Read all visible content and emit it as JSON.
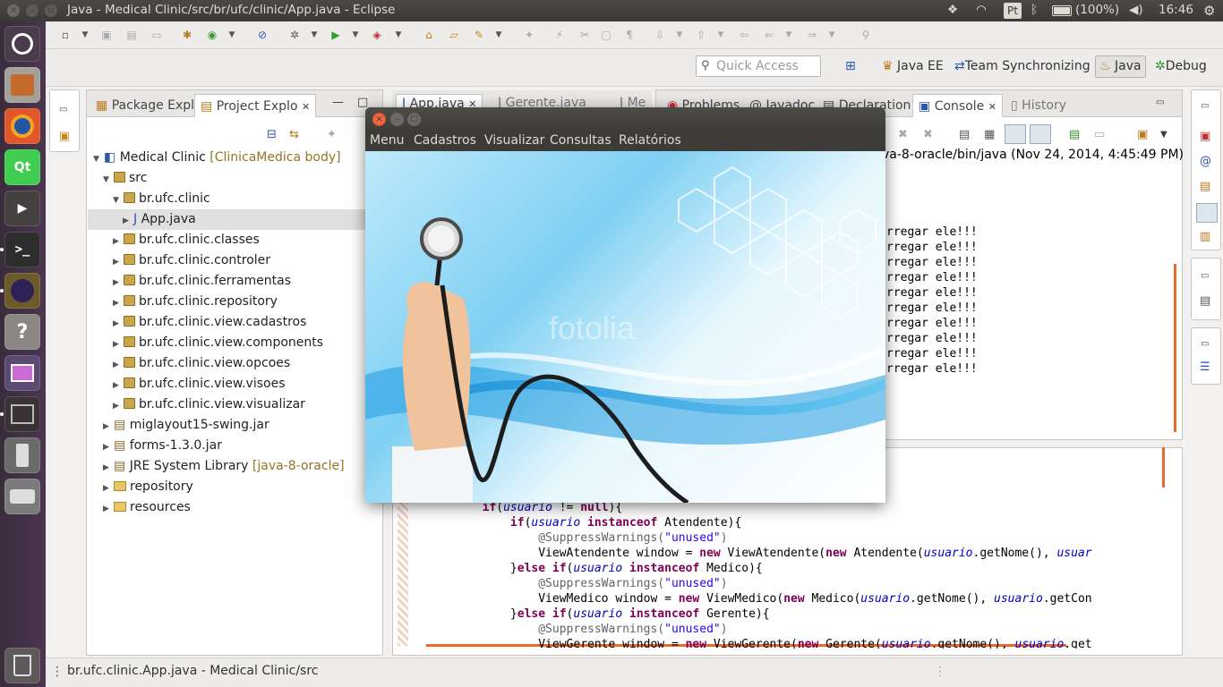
{
  "top_panel": {
    "title": "Java - Medical Clinic/src/br/ufc/clinic/App.java - Eclipse",
    "keyboard": "Pt",
    "battery": "(100%)",
    "time": "16:46",
    "icons": [
      "dropbox-icon",
      "wifi-icon",
      "keyboard-layout-icon",
      "bluetooth-icon",
      "battery-icon",
      "volume-icon",
      "settings-gear-icon"
    ]
  },
  "launcher": {
    "items": [
      "dash-home-icon",
      "files-icon",
      "firefox-icon",
      "qt-creator-icon",
      "video-editor-icon",
      "terminal-icon",
      "eclipse-icon",
      "help-icon",
      "workspace-switcher-icon",
      "system-monitor-icon",
      "usb-drive-icon",
      "disk-drive-icon",
      "trash-icon"
    ]
  },
  "toolbar": {
    "quick_access_placeholder": "Quick Access",
    "perspectives": [
      "Java EE",
      "Team Synchronizing",
      "Java",
      "Debug"
    ]
  },
  "left_pane": {
    "tabs": [
      "Package Expl",
      "Project Explo"
    ],
    "tree": [
      {
        "label": "Medical Clinic",
        "deco": "[ClinicaMedica body]",
        "level": 0,
        "expanded": true,
        "kind": "project"
      },
      {
        "label": "src",
        "level": 1,
        "expanded": true,
        "kind": "srcfolder"
      },
      {
        "label": "br.ufc.clinic",
        "level": 2,
        "expanded": true,
        "kind": "package"
      },
      {
        "label": "App.java",
        "level": 3,
        "expanded": false,
        "kind": "java",
        "selected": true
      },
      {
        "label": "br.ufc.clinic.classes",
        "level": 2,
        "kind": "package"
      },
      {
        "label": "br.ufc.clinic.controler",
        "level": 2,
        "kind": "package"
      },
      {
        "label": "br.ufc.clinic.ferramentas",
        "level": 2,
        "kind": "package"
      },
      {
        "label": "br.ufc.clinic.repository",
        "level": 2,
        "kind": "package"
      },
      {
        "label": "br.ufc.clinic.view.cadastros",
        "level": 2,
        "kind": "package"
      },
      {
        "label": "br.ufc.clinic.view.components",
        "level": 2,
        "kind": "package"
      },
      {
        "label": "br.ufc.clinic.view.opcoes",
        "level": 2,
        "kind": "package"
      },
      {
        "label": "br.ufc.clinic.view.visoes",
        "level": 2,
        "kind": "package"
      },
      {
        "label": "br.ufc.clinic.view.visualizar",
        "level": 2,
        "kind": "package"
      },
      {
        "label": "miglayout15-swing.jar",
        "level": 1,
        "kind": "jar"
      },
      {
        "label": "forms-1.3.0.jar",
        "level": 1,
        "kind": "jar"
      },
      {
        "label": "JRE System Library",
        "deco": "[java-8-oracle]",
        "level": 1,
        "kind": "library"
      },
      {
        "label": "repository",
        "level": 1,
        "kind": "folder"
      },
      {
        "label": "resources",
        "level": 1,
        "kind": "folder"
      }
    ]
  },
  "editor_tabs": [
    "App.java",
    "Gerente.java",
    "Me"
  ],
  "console": {
    "tabs": [
      "Problems",
      "Javadoc",
      "Declaration",
      "Console",
      "History"
    ],
    "header": "va-8-oracle/bin/java (Nov 24, 2014, 4:45:49 PM)",
    "lines": [
      "rregar ele!!!",
      "rregar ele!!!",
      "rregar ele!!!",
      "rregar ele!!!",
      "rregar ele!!!",
      "rregar ele!!!",
      "rregar ele!!!",
      "rregar ele!!!",
      "rregar ele!!!",
      "rregar ele!!!"
    ]
  },
  "code": {
    "lines": [
      {
        "indent": "        ",
        "tokens": [
          [
            "kw",
            "if"
          ],
          [
            "",
            "("
          ],
          [
            "var",
            "usuario"
          ],
          [
            "",
            " != "
          ],
          [
            "kw",
            "null"
          ],
          [
            "",
            "){"
          ]
        ]
      },
      {
        "indent": "            ",
        "tokens": [
          [
            "kw",
            "if"
          ],
          [
            "",
            "("
          ],
          [
            "var",
            "usuario"
          ],
          [
            "",
            " "
          ],
          [
            "kw",
            "instanceof"
          ],
          [
            "",
            " Atendente){"
          ]
        ]
      },
      {
        "indent": "                ",
        "tokens": [
          [
            "ann",
            "@SuppressWarnings("
          ],
          [
            "str",
            "\"unused\""
          ],
          [
            "ann",
            ")"
          ]
        ]
      },
      {
        "indent": "                ",
        "tokens": [
          [
            "",
            "ViewAtendente window = "
          ],
          [
            "kw",
            "new"
          ],
          [
            "",
            " ViewAtendente("
          ],
          [
            "kw",
            "new"
          ],
          [
            "",
            " Atendente("
          ],
          [
            "var",
            "usuario"
          ],
          [
            "",
            ".getNome(), "
          ],
          [
            "var",
            "usuar"
          ]
        ]
      },
      {
        "indent": "            ",
        "tokens": [
          [
            "",
            "}"
          ],
          [
            "kw",
            "else if"
          ],
          [
            "",
            "("
          ],
          [
            "var",
            "usuario"
          ],
          [
            "",
            " "
          ],
          [
            "kw",
            "instanceof"
          ],
          [
            "",
            " Medico){"
          ]
        ]
      },
      {
        "indent": "                ",
        "tokens": [
          [
            "ann",
            "@SuppressWarnings("
          ],
          [
            "str",
            "\"unused\""
          ],
          [
            "ann",
            ")"
          ]
        ]
      },
      {
        "indent": "                ",
        "tokens": [
          [
            "",
            "ViewMedico window = "
          ],
          [
            "kw",
            "new"
          ],
          [
            "",
            " ViewMedico("
          ],
          [
            "kw",
            "new"
          ],
          [
            "",
            " Medico("
          ],
          [
            "var",
            "usuario"
          ],
          [
            "",
            ".getNome(), "
          ],
          [
            "var",
            "usuario"
          ],
          [
            "",
            ".getCon"
          ]
        ]
      },
      {
        "indent": "            ",
        "tokens": [
          [
            "",
            "}"
          ],
          [
            "kw",
            "else if"
          ],
          [
            "",
            "("
          ],
          [
            "var",
            "usuario"
          ],
          [
            "",
            " "
          ],
          [
            "kw",
            "instanceof"
          ],
          [
            "",
            " Gerente){"
          ]
        ]
      },
      {
        "indent": "                ",
        "tokens": [
          [
            "ann",
            "@SuppressWarnings("
          ],
          [
            "str",
            "\"unused\""
          ],
          [
            "ann",
            ")"
          ]
        ]
      },
      {
        "indent": "                ",
        "tokens": [
          [
            "",
            "ViewGerente window = "
          ],
          [
            "kw",
            "new"
          ],
          [
            "",
            " ViewGerente("
          ],
          [
            "kw",
            "new"
          ],
          [
            "",
            " Gerente("
          ],
          [
            "var",
            "usuario"
          ],
          [
            "",
            ".getNome(), "
          ],
          [
            "var",
            "usuario"
          ],
          [
            "",
            ".get"
          ]
        ]
      }
    ]
  },
  "app_window": {
    "menu": [
      "Menu",
      "Cadastros",
      "Visualizar",
      "Consultas",
      "Relatórios"
    ],
    "watermark": "fotolia"
  },
  "status_bar": {
    "text": "br.ufc.clinic.App.java - Medical Clinic/src"
  },
  "colors": {
    "accent_orange": "#e9692c",
    "ubuntu_panel": "#3c3b37",
    "launcher": "#3f2e43",
    "selection": "#e0e0e0"
  }
}
